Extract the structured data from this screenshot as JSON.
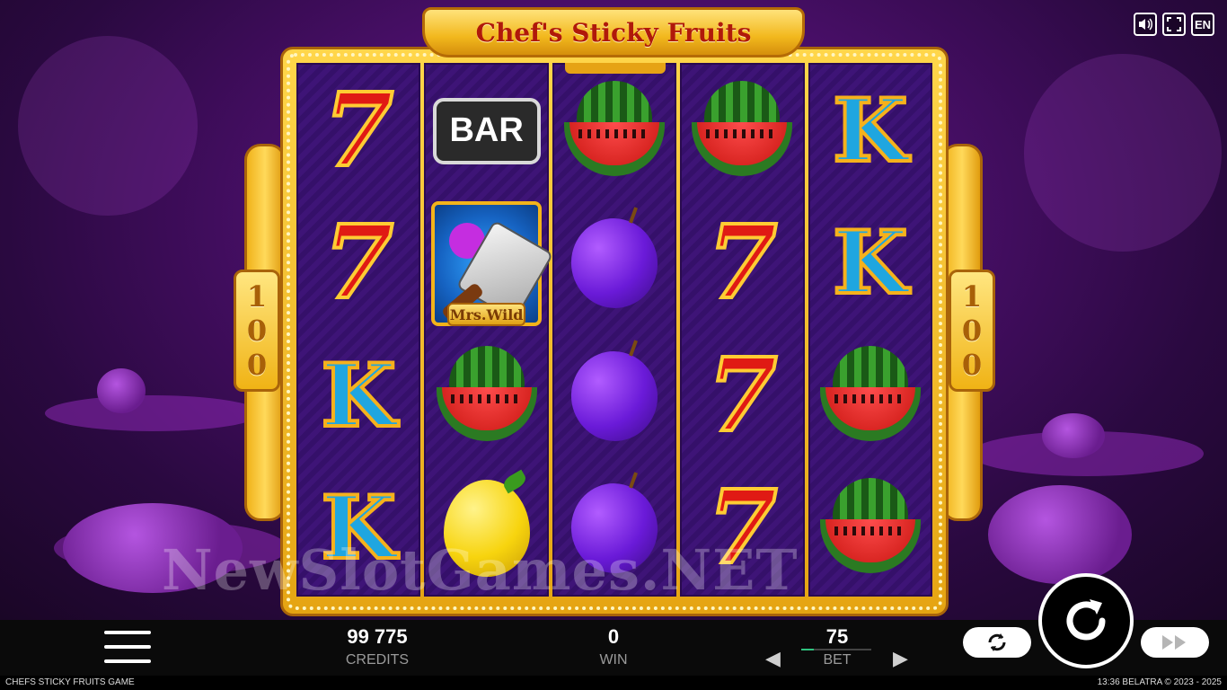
{
  "game": {
    "title": "Chef's Sticky Fruits",
    "multiplier_left": "100",
    "multiplier_right": "100",
    "wild_label": "Mrs.Wild",
    "watermark": "NewSlotGames.NET",
    "reels": [
      [
        "seven",
        "seven",
        "k",
        "k"
      ],
      [
        "bar",
        "wild",
        "watermelon",
        "lemon"
      ],
      [
        "watermelon",
        "plum",
        "plum",
        "plum"
      ],
      [
        "watermelon",
        "seven",
        "seven",
        "seven"
      ],
      [
        "k",
        "k",
        "watermelon",
        "watermelon"
      ]
    ],
    "bar_label": "BAR"
  },
  "top_buttons": {
    "sound_icon": "speaker-icon",
    "fullscreen_icon": "fullscreen-icon",
    "language": "EN"
  },
  "bottom_bar": {
    "credits_value": "99 775",
    "credits_label": "CREDITS",
    "win_value": "0",
    "win_label": "WIN",
    "bet_value": "75",
    "bet_label": "BET"
  },
  "footer": {
    "game_name": "CHEFS STICKY FRUITS GAME",
    "time_copyright": "13:36  BELATRA © 2023 - 2025"
  },
  "colors": {
    "accent_gold": "#f2b81d",
    "background_purple": "#4b0f6b",
    "seven_red": "#e01a14",
    "k_blue": "#1fa6e0"
  }
}
